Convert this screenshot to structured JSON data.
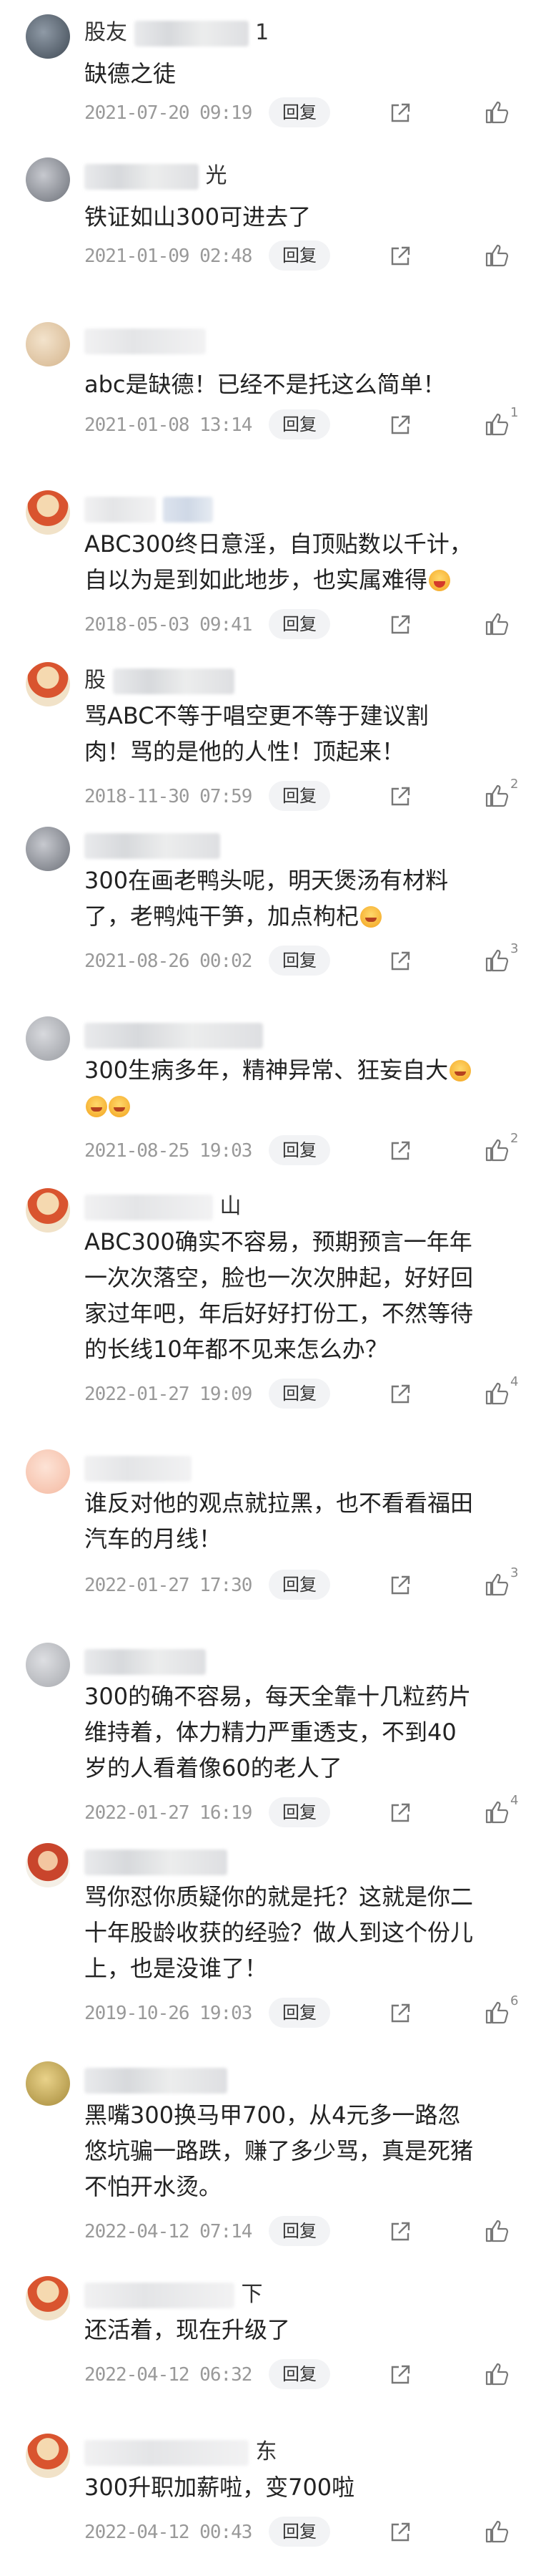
{
  "reply_label": "回复",
  "comments": [
    {
      "username": "股友",
      "username_suffix": "1",
      "lines": [
        "缺德之徒"
      ],
      "date": "2021-07-20 09:19",
      "likes": ""
    },
    {
      "username": "",
      "username_suffix": "光",
      "lines": [
        "铁证如山300可进去了"
      ],
      "date": "2021-01-09 02:48",
      "likes": ""
    },
    {
      "username": "",
      "username_suffix": "",
      "lines": [
        "abc是缺德！已经不是托这么简单！"
      ],
      "date": "2021-01-08 13:14",
      "likes": "1"
    },
    {
      "username": "",
      "username_suffix": "",
      "lines": [
        "ABC300终日意淫，自顶贴数以千计，",
        "自以为是到如此地步，也实属难得"
      ],
      "date": "2018-05-03 09:41",
      "likes": ""
    },
    {
      "username": "股",
      "username_suffix": "",
      "lines": [
        "骂ABC不等于唱空更不等于建议割",
        "肉！骂的是他的人性！顶起来！"
      ],
      "date": "2018-11-30 07:59",
      "likes": "2"
    },
    {
      "username": "",
      "username_suffix": "",
      "lines": [
        "300在画老鸭头呢，明天煲汤有材料",
        "了，老鸭炖干笋，加点枸杞"
      ],
      "date": "2021-08-26 00:02",
      "likes": "3"
    },
    {
      "username": "",
      "username_suffix": "",
      "lines": [
        "300生病多年，精神异常、狂妄自大",
        ""
      ],
      "date": "2021-08-25 19:03",
      "likes": "2"
    },
    {
      "username": "",
      "username_suffix": "山",
      "lines": [
        "ABC300确实不容易，预期预言一年年",
        "一次次落空，脸也一次次肿起，好好回",
        "家过年吧，年后好好打份工，不然等待",
        "的长线10年都不见来怎么办？"
      ],
      "date": "2022-01-27 19:09",
      "likes": "4"
    },
    {
      "username": "",
      "username_suffix": "",
      "lines": [
        "谁反对他的观点就拉黑，也不看看福田",
        "汽车的月线！"
      ],
      "date": "2022-01-27 17:30",
      "likes": "3"
    },
    {
      "username": "",
      "username_suffix": "",
      "lines": [
        "300的确不容易，每天全靠十几粒药片",
        "维持着，体力精力严重透支，不到40",
        "岁的人看着像60的老人了"
      ],
      "date": "2022-01-27 16:19",
      "likes": "4"
    },
    {
      "username": "",
      "username_suffix": "",
      "lines": [
        "骂你怼你质疑你的就是托？这就是你二",
        "十年股龄收获的经验？做人到这个份儿",
        "上，也是没谁了！"
      ],
      "date": "2019-10-26 19:03",
      "likes": "6"
    },
    {
      "username": "",
      "username_suffix": "",
      "lines": [
        "黑嘴300换马甲700，从4元多一路忽",
        "悠坑骗一路跌，赚了多少骂，真是死猪",
        "不怕开水烫。"
      ],
      "date": "2022-04-12 07:14",
      "likes": ""
    },
    {
      "username": "",
      "username_suffix": "下",
      "lines": [
        "还活着，现在升级了"
      ],
      "date": "2022-04-12 06:32",
      "likes": ""
    },
    {
      "username": "",
      "username_suffix": "东",
      "lines": [
        "300升职加薪啦，变700啦"
      ],
      "date": "2022-04-12 00:43",
      "likes": ""
    }
  ],
  "icons": {
    "share": "share-icon",
    "like": "thumbs-up-icon"
  },
  "colors": {
    "meta_text": "#999999",
    "reply_bg": "#f2f3f5",
    "emoji": "#f3a31e"
  }
}
